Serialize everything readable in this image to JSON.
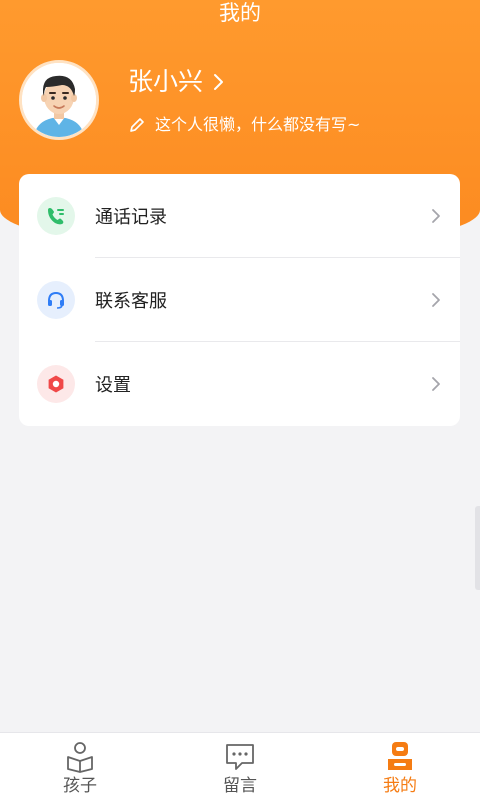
{
  "header": {
    "title": "我的"
  },
  "profile": {
    "name": "张小兴",
    "signature": "这个人很懒，什么都没有写~"
  },
  "menu": {
    "items": [
      {
        "label": "通话记录",
        "icon": "phone-icon"
      },
      {
        "label": "联系客服",
        "icon": "headset-icon"
      },
      {
        "label": "设置",
        "icon": "gear-icon"
      }
    ]
  },
  "tabbar": {
    "tabs": [
      {
        "label": "孩子",
        "icon": "child-reading-icon"
      },
      {
        "label": "留言",
        "icon": "message-bubble-icon"
      },
      {
        "label": "我的",
        "icon": "profile-icon",
        "active": true
      }
    ]
  },
  "colors": {
    "brand_orange": "#fc8a20",
    "active_tab": "#f57c13",
    "call_green": "#2fbd6a",
    "service_blue": "#2f7df6",
    "settings_red": "#f04848"
  }
}
